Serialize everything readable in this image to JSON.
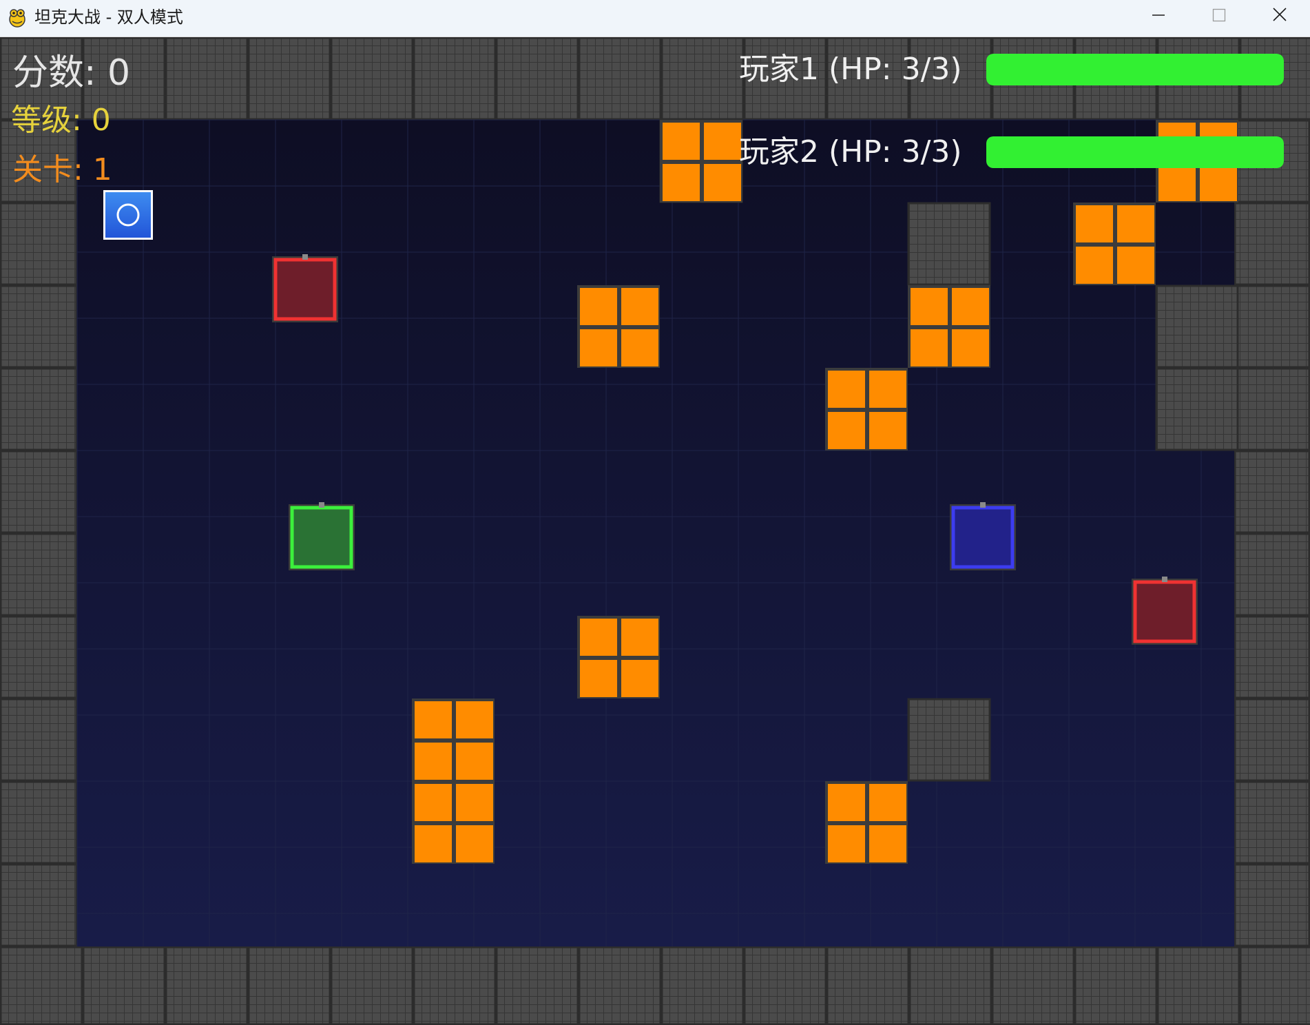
{
  "window": {
    "title": "坦克大战 - 双人模式",
    "icon": "pygame-snake-icon",
    "controls": [
      "minimize-icon",
      "maximize-icon",
      "close-icon"
    ]
  },
  "hud": {
    "score_text": "分数: 0",
    "level_text": "等级: 0",
    "stage_text": "关卡: 1",
    "player1": {
      "label": "玩家1 (HP: 3/3)",
      "hp": 3,
      "hp_max": 3
    },
    "player2": {
      "label": "玩家2 (HP: 3/3)",
      "hp": 3,
      "hp_max": 3
    }
  },
  "colors": {
    "background": "#12122c",
    "steel_wall": "#4a4a4a",
    "brick_wall": "#ff8c00",
    "player1_tank": "#2a7234",
    "player1_outline": "#3cf03c",
    "player2_tank": "#22228a",
    "player2_outline": "#3c3cf0",
    "enemy_tank": "#6e1e2a",
    "enemy_outline": "#f03232",
    "hp_bar": "#32f032",
    "powerup": "#2d6ee6"
  },
  "board": {
    "cols": 16,
    "rows": 12,
    "steel_tiles": [
      [
        7,
        1
      ],
      [
        10,
        2
      ],
      [
        13,
        3
      ],
      [
        13,
        4
      ],
      [
        10,
        8
      ]
    ],
    "brick_tiles": [
      [
        7,
        1
      ],
      [
        13,
        1
      ],
      [
        12,
        2
      ],
      [
        6,
        3
      ],
      [
        10,
        3
      ],
      [
        9,
        4
      ],
      [
        6,
        7
      ],
      [
        4,
        8
      ],
      [
        4,
        9
      ],
      [
        9,
        9
      ]
    ],
    "tanks": [
      {
        "kind": "enemy",
        "col": 3,
        "row": 2.6
      },
      {
        "kind": "player1",
        "col": 3.2,
        "row": 5.6
      },
      {
        "kind": "player2",
        "col": 11.2,
        "row": 5.6
      },
      {
        "kind": "enemy",
        "col": 13.4,
        "row": 6.5
      }
    ],
    "powerups": [
      {
        "kind": "shield",
        "icon": "ring-icon"
      }
    ]
  }
}
